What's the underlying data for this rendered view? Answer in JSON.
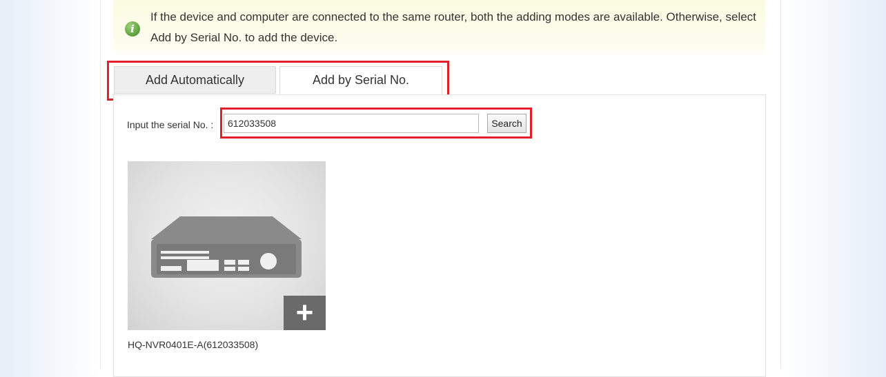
{
  "notice": {
    "icon": "info-icon",
    "text": "If the device and computer are connected to the same router, both the adding modes are available. Otherwise, select Add by Serial No. to add the device."
  },
  "tabs": [
    {
      "label": "Add Automatically",
      "active": false
    },
    {
      "label": "Add by Serial No.",
      "active": true
    }
  ],
  "serial_search": {
    "label": "Input the serial No. :",
    "value": "612033508",
    "button_label": "Search"
  },
  "device": {
    "icon": "nvr-device-icon",
    "add_icon": "plus-icon",
    "add_symbol": "+",
    "name": "HQ-NVR0401E-A(612033508)"
  },
  "colors": {
    "highlight": "#e0212b",
    "notice_bg": "#fafbe0",
    "info_icon": "#5d9e3b",
    "add_button_bg": "#6a6a6a"
  }
}
